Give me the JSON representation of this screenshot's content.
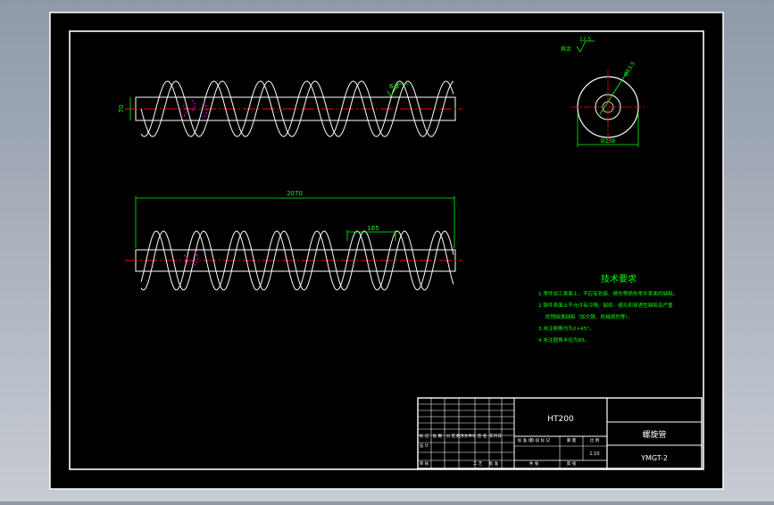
{
  "view1": {
    "diameter_label": "70",
    "roughness_value": "6.3"
  },
  "view2": {
    "length_label": "2070",
    "pitch_label": "165"
  },
  "section": {
    "roughness_prefix": "其余",
    "roughness_value": "12.5",
    "hole_dim": "Ø53.5",
    "outer_dim": "Ø238"
  },
  "tech_requirements": {
    "title": "技术要求",
    "items": [
      "1.零件加工表面上，不应有划痕、擦伤等损伤零件表面的缺陷。",
      "2.铸件表面上不允许有冷隔、裂纹、缩孔和穿透性缺陷及严重",
      "的残缺类缺陷（如欠铸、机械损伤等）。",
      "3.未注倒角均为2×45°。",
      "4.未注圆角半径为R5。"
    ]
  },
  "title_block": {
    "material": "HT200",
    "part_name": "螺旋管",
    "drawing_no": "YMGT-2",
    "scale": "1:10",
    "small_labels": [
      "标 记",
      "处 数",
      "分 区",
      "更改文件号",
      "签 名",
      "年月日",
      "设 计",
      "审 核",
      "工 艺",
      "批 准",
      "标 准 化",
      "阶 段 标 记",
      "重 量",
      "比 例",
      "共 张",
      "第 张"
    ]
  },
  "colors": {
    "background": "#000000",
    "frame": "#ffffff",
    "centerline": "#ff0000",
    "dimension": "#00ff00",
    "text_green": "#00ff00",
    "hatch_magenta": "#ff00ff"
  }
}
